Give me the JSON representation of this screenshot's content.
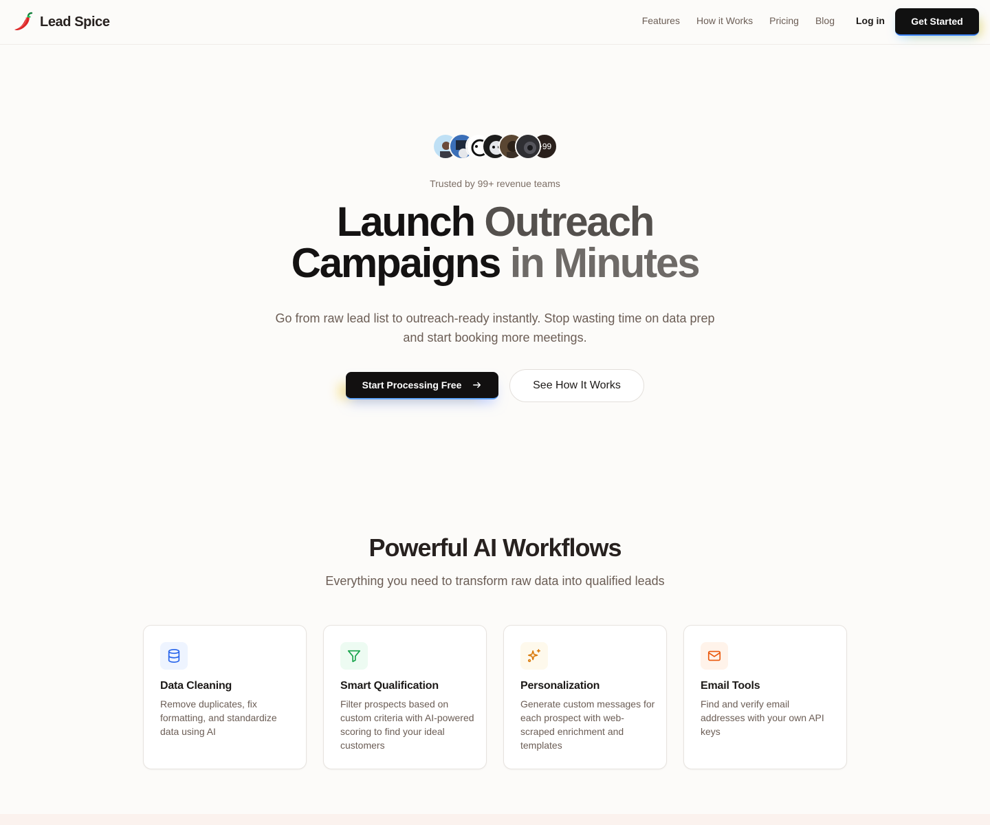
{
  "brand": {
    "name": "Lead Spice"
  },
  "nav": {
    "links": [
      "Features",
      "How it Works",
      "Pricing",
      "Blog"
    ],
    "login_label": "Log in",
    "cta_label": "Get Started"
  },
  "hero": {
    "avatar_more": "+99",
    "trusted_text": "Trusted by 99+ revenue teams",
    "headline": {
      "word1": "Launch",
      "word2": "Outreach",
      "word3": "Campaigns",
      "word4": "in Minutes"
    },
    "subtext": "Go from raw lead list to outreach-ready instantly. Stop wasting time on data prep and start booking more meetings.",
    "primary_cta": "Start Processing Free",
    "secondary_cta": "See How It Works"
  },
  "features": {
    "title": "Powerful AI Workflows",
    "subtitle": "Everything you need to transform raw data into qualified leads",
    "cards": [
      {
        "title": "Data Cleaning",
        "description": "Remove duplicates, fix formatting, and standardize data using AI",
        "icon": "database-icon",
        "color": "#2563eb",
        "bg": "#eef4ff"
      },
      {
        "title": "Smart Qualification",
        "description": "Filter prospects based on custom criteria with AI-powered scoring to find your ideal customers",
        "icon": "filter-icon",
        "color": "#16a34a",
        "bg": "#edfbf2"
      },
      {
        "title": "Personalization",
        "description": "Generate custom messages for each prospect with web-scraped enrichment and templates",
        "icon": "sparkles-icon",
        "color": "#d97706",
        "bg": "#fef9ec"
      },
      {
        "title": "Email Tools",
        "description": "Find and verify email addresses with your own API keys",
        "icon": "mail-icon",
        "color": "#ea580c",
        "bg": "#fff3ea"
      }
    ]
  }
}
